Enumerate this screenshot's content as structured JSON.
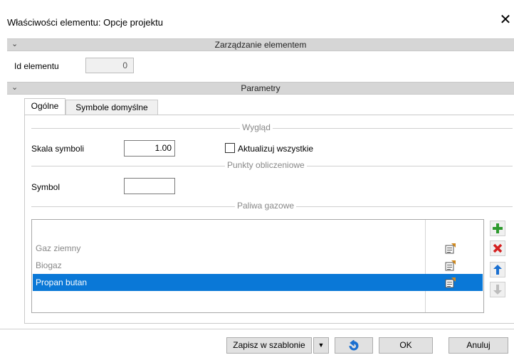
{
  "window": {
    "title": "Właściwości elementu: Opcje projektu",
    "close": "✕"
  },
  "sections": {
    "management": {
      "label": "Zarządzanie elementem",
      "chevron": "⌄"
    },
    "parameters": {
      "label": "Parametry",
      "chevron": "⌄"
    }
  },
  "element_id": {
    "label": "Id elementu",
    "value": "0"
  },
  "tabs": [
    {
      "label": "Ogólne"
    },
    {
      "label": "Symbole domyślne"
    }
  ],
  "groups": {
    "appearance": "Wygląd",
    "calc_points": "Punkty obliczeniowe",
    "gas_fuels": "Paliwa gazowe"
  },
  "symbol_scale": {
    "label": "Skala symboli",
    "value": "1.00"
  },
  "update_all": {
    "label": "Aktualizuj wszystkie",
    "checked": false
  },
  "symbol": {
    "label": "Symbol",
    "value": ""
  },
  "fuels": [
    {
      "name": "Gaz ziemny",
      "selected": false
    },
    {
      "name": "Biogaz",
      "selected": false
    },
    {
      "name": "Propan butan",
      "selected": true
    }
  ],
  "side_buttons": {
    "add": "add-icon",
    "delete": "delete-icon",
    "up": "arrow-up-icon",
    "down": "arrow-down-icon"
  },
  "footer": {
    "save_template": "Zapisz w szablonie",
    "dropdown": "▼",
    "ok": "OK",
    "cancel": "Anuluj"
  },
  "colors": {
    "selection": "#0a78d7",
    "add": "#2e9a2e",
    "delete": "#d42020",
    "up": "#1a6fd0"
  }
}
